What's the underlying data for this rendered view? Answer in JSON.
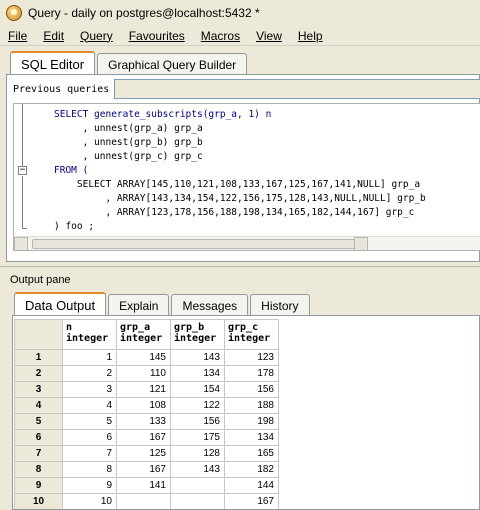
{
  "window": {
    "title": "Query - daily on postgres@localhost:5432 *"
  },
  "menu": [
    "File",
    "Edit",
    "Query",
    "Favourites",
    "Macros",
    "View",
    "Help"
  ],
  "editor_tabs": [
    "SQL Editor",
    "Graphical Query Builder"
  ],
  "previous_queries_label": "Previous queries",
  "sql_lines": [
    "SELECT generate_subscripts(grp_a, 1) n",
    "     , unnest(grp_a) grp_a",
    "     , unnest(grp_b) grp_b",
    "     , unnest(grp_c) grp_c",
    "FROM (",
    "    SELECT ARRAY[145,110,121,108,133,167,125,167,141,NULL] grp_a",
    "         , ARRAY[143,134,154,122,156,175,128,143,NULL,NULL] grp_b",
    "         , ARRAY[123,178,156,188,198,134,165,182,144,167] grp_c",
    ") foo ;"
  ],
  "output_pane_label": "Output pane",
  "output_tabs": [
    "Data Output",
    "Explain",
    "Messages",
    "History"
  ],
  "grid": {
    "columns": [
      {
        "name": "n",
        "type": "integer"
      },
      {
        "name": "grp_a",
        "type": "integer"
      },
      {
        "name": "grp_b",
        "type": "integer"
      },
      {
        "name": "grp_c",
        "type": "integer"
      }
    ],
    "rows": [
      {
        "num": "1",
        "n": "1",
        "grp_a": "145",
        "grp_b": "143",
        "grp_c": "123"
      },
      {
        "num": "2",
        "n": "2",
        "grp_a": "110",
        "grp_b": "134",
        "grp_c": "178"
      },
      {
        "num": "3",
        "n": "3",
        "grp_a": "121",
        "grp_b": "154",
        "grp_c": "156"
      },
      {
        "num": "4",
        "n": "4",
        "grp_a": "108",
        "grp_b": "122",
        "grp_c": "188"
      },
      {
        "num": "5",
        "n": "5",
        "grp_a": "133",
        "grp_b": "156",
        "grp_c": "198"
      },
      {
        "num": "6",
        "n": "6",
        "grp_a": "167",
        "grp_b": "175",
        "grp_c": "134"
      },
      {
        "num": "7",
        "n": "7",
        "grp_a": "125",
        "grp_b": "128",
        "grp_c": "165"
      },
      {
        "num": "8",
        "n": "8",
        "grp_a": "167",
        "grp_b": "143",
        "grp_c": "182"
      },
      {
        "num": "9",
        "n": "9",
        "grp_a": "141",
        "grp_b": "",
        "grp_c": "144"
      },
      {
        "num": "10",
        "n": "10",
        "grp_a": "",
        "grp_b": "",
        "grp_c": "167"
      }
    ]
  }
}
